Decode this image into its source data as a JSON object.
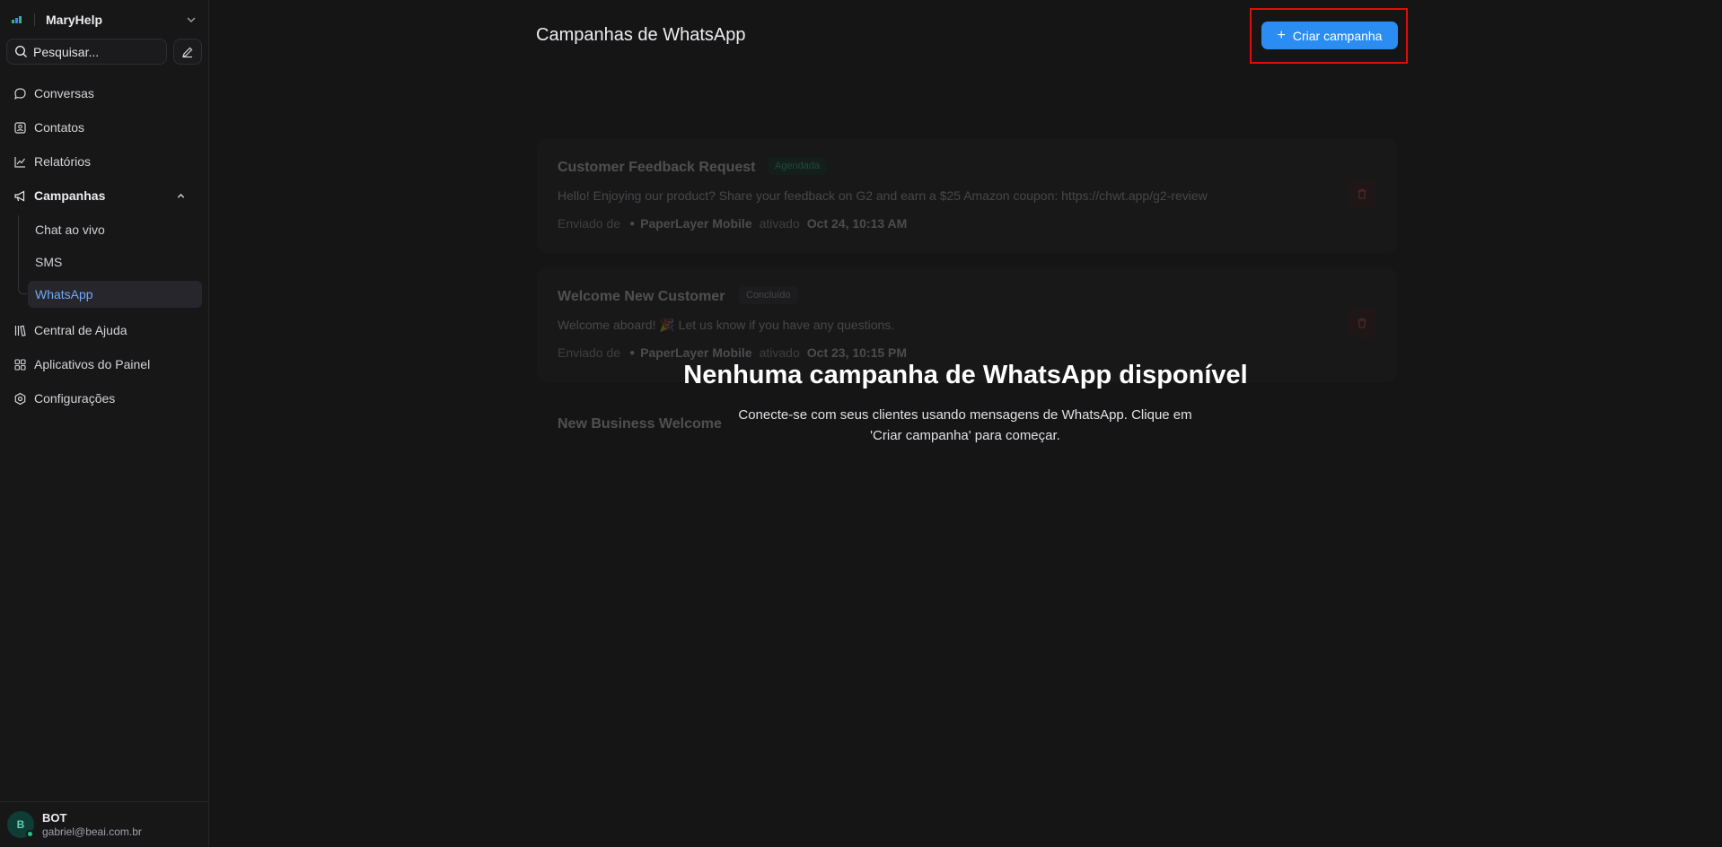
{
  "sidebar": {
    "brand_name": "MaryHelp",
    "search_placeholder": "Pesquisar...",
    "nav": {
      "conversas": "Conversas",
      "contatos": "Contatos",
      "relatorios": "Relatórios",
      "campanhas": "Campanhas",
      "central_ajuda": "Central de Ajuda",
      "aplicativos": "Aplicativos do Painel",
      "configuracoes": "Configurações"
    },
    "campaign_sub": {
      "chat": "Chat ao vivo",
      "sms": "SMS",
      "whatsapp": "WhatsApp"
    },
    "user": {
      "initial": "B",
      "name": "BOT",
      "email": "gabriel@beai.com.br"
    }
  },
  "header": {
    "title": "Campanhas de WhatsApp",
    "create_button": "Criar campanha"
  },
  "campaigns": [
    {
      "title": "Customer Feedback Request",
      "status": "Agendada",
      "message": "Hello! Enjoying our product? Share your feedback on G2 and earn a $25 Amazon coupon: https://chwt.app/g2-review",
      "sent_from_label": "Enviado de",
      "inbox": "PaperLayer Mobile",
      "triggered_label": "ativado",
      "date": "Oct 24, 10:13 AM"
    },
    {
      "title": "Welcome New Customer",
      "status": "Concluído",
      "message": "Welcome aboard! 🎉 Let us know if you have any questions.",
      "sent_from_label": "Enviado de",
      "inbox": "PaperLayer Mobile",
      "triggered_label": "ativado",
      "date": "Oct 23, 10:15 PM"
    },
    {
      "title": "New Business Welcome"
    }
  ],
  "empty_state": {
    "title": "Nenhuma campanha de WhatsApp disponível",
    "description_line1": "Conecte-se com seus clientes usando mensagens de WhatsApp. Clique em",
    "description_line2": "'Criar campanha' para começar."
  },
  "colors": {
    "accent": "#2b8df2",
    "active_nav_text": "#72a9f7",
    "highlight": "#e10d0d"
  }
}
